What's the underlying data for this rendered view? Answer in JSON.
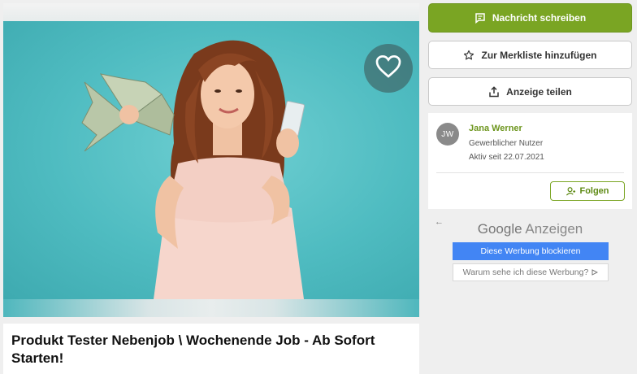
{
  "listing": {
    "title": "Produkt Tester Nebenjob \\ Wochenende Job - Ab Sofort Starten!"
  },
  "gallery": {
    "favorite_icon": "heart-outline-icon"
  },
  "actions": {
    "message_label": "Nachricht schreiben",
    "watchlist_label": "Zur Merkliste hinzufügen",
    "share_label": "Anzeige teilen"
  },
  "seller": {
    "initials": "JW",
    "name": "Jana Werner",
    "type": "Gewerblicher Nutzer",
    "active_since": "Aktiv seit 22.07.2021",
    "follow_label": "Folgen"
  },
  "ad": {
    "back_glyph": "←",
    "brand_google": "Google",
    "brand_ads": "Anzeigen",
    "block_label": "Diese Werbung blockieren",
    "why_label": "Warum sehe ich diese Werbung?"
  },
  "colors": {
    "accent": "#7aa523",
    "photo_bg": "#4fbcc1",
    "google_blue": "#4285f4"
  }
}
